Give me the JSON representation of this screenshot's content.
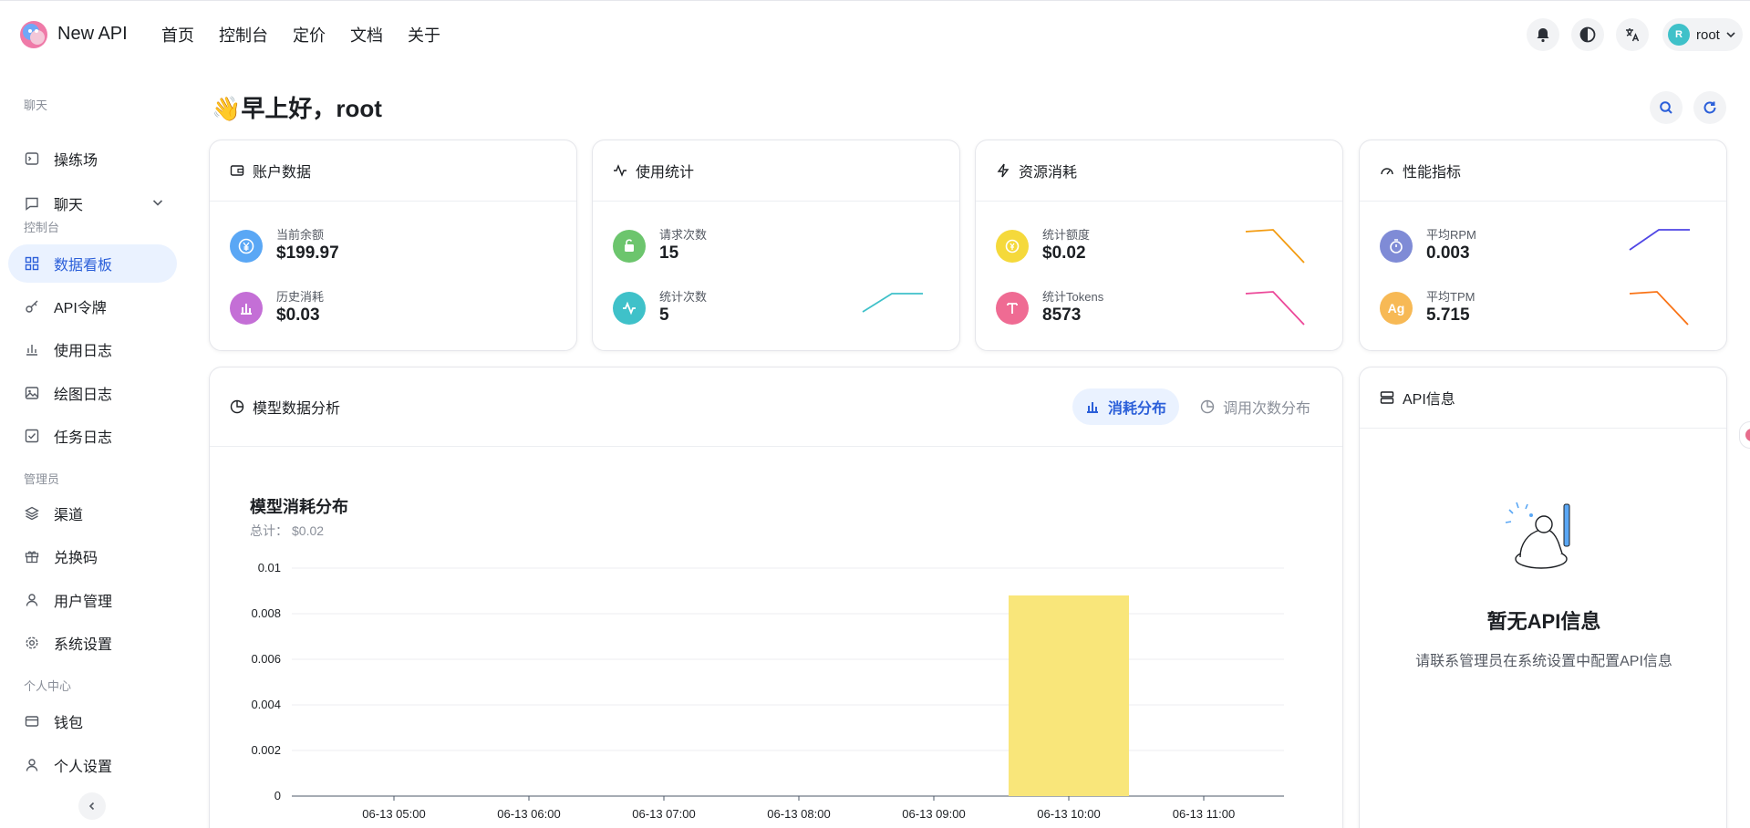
{
  "app": {
    "name": "New API"
  },
  "topnav": {
    "items": [
      "首页",
      "控制台",
      "定价",
      "文档",
      "关于"
    ]
  },
  "user": {
    "avatar_letter": "R",
    "name": "root"
  },
  "sidebar": {
    "sections": {
      "chat": "聊天",
      "console": "控制台",
      "admin": "管理员",
      "personal": "个人中心"
    },
    "items": [
      {
        "label": "操练场",
        "icon": "terminal-icon"
      },
      {
        "label": "聊天",
        "icon": "message-icon"
      },
      {
        "label": "数据看板",
        "icon": "dashboard-icon"
      },
      {
        "label": "API令牌",
        "icon": "key-icon"
      },
      {
        "label": "使用日志",
        "icon": "bar-chart-icon"
      },
      {
        "label": "绘图日志",
        "icon": "image-icon"
      },
      {
        "label": "任务日志",
        "icon": "checkbox-icon"
      },
      {
        "label": "渠道",
        "icon": "layers-icon"
      },
      {
        "label": "兑换码",
        "icon": "gift-icon"
      },
      {
        "label": "用户管理",
        "icon": "user-icon"
      },
      {
        "label": "系统设置",
        "icon": "settings-icon"
      },
      {
        "label": "钱包",
        "icon": "wallet-icon"
      },
      {
        "label": "个人设置",
        "icon": "user-icon"
      }
    ]
  },
  "greeting": {
    "emoji": "👋",
    "text": "早上好，root"
  },
  "cards": {
    "account": {
      "title": "账户数据",
      "balance_label": "当前余额",
      "balance_value": "$199.97",
      "spent_label": "历史消耗",
      "spent_value": "$0.03"
    },
    "usage": {
      "title": "使用统计",
      "requests_label": "请求次数",
      "requests_value": "15",
      "stat_count_label": "统计次数",
      "stat_count_value": "5"
    },
    "resource": {
      "title": "资源消耗",
      "quota_label": "统计额度",
      "quota_value": "$0.02",
      "tokens_label": "统计Tokens",
      "tokens_value": "8573"
    },
    "performance": {
      "title": "性能指标",
      "rpm_label": "平均RPM",
      "rpm_value": "0.003",
      "tpm_label": "平均TPM",
      "tpm_value": "5.715"
    }
  },
  "analysis": {
    "title": "模型数据分析",
    "tab_consumption": "消耗分布",
    "tab_calls": "调用次数分布",
    "total_label": "总计：",
    "total_value": "$0.02"
  },
  "api_info": {
    "title": "API信息",
    "empty_title": "暂无API信息",
    "empty_desc": "请联系管理员在系统设置中配置API信息"
  },
  "colors": {
    "accent": "#2b5fd9",
    "bar": "#f9e67a",
    "balance_icon": "#5aa7f5",
    "spent_icon": "#c46fd6",
    "requests_icon": "#6cc56d",
    "stat_count_icon": "#3fc1c9",
    "quota_icon": "#f5d93b",
    "tokens_icon": "#ef6b93",
    "rpm_icon": "#7f8bd6",
    "tpm_icon": "#f7b955"
  },
  "chart_data": {
    "type": "bar",
    "title": "模型消耗分布",
    "categories": [
      "06-13 05:00",
      "06-13 06:00",
      "06-13 07:00",
      "06-13 08:00",
      "06-13 09:00",
      "06-13 10:00",
      "06-13 11:00"
    ],
    "values": [
      0,
      0,
      0,
      0,
      0,
      0.0088,
      0
    ],
    "ylim": [
      0,
      0.01
    ],
    "yticks": [
      "0",
      "0.002",
      "0.004",
      "0.006",
      "0.008",
      "0.01"
    ],
    "grid": true
  }
}
